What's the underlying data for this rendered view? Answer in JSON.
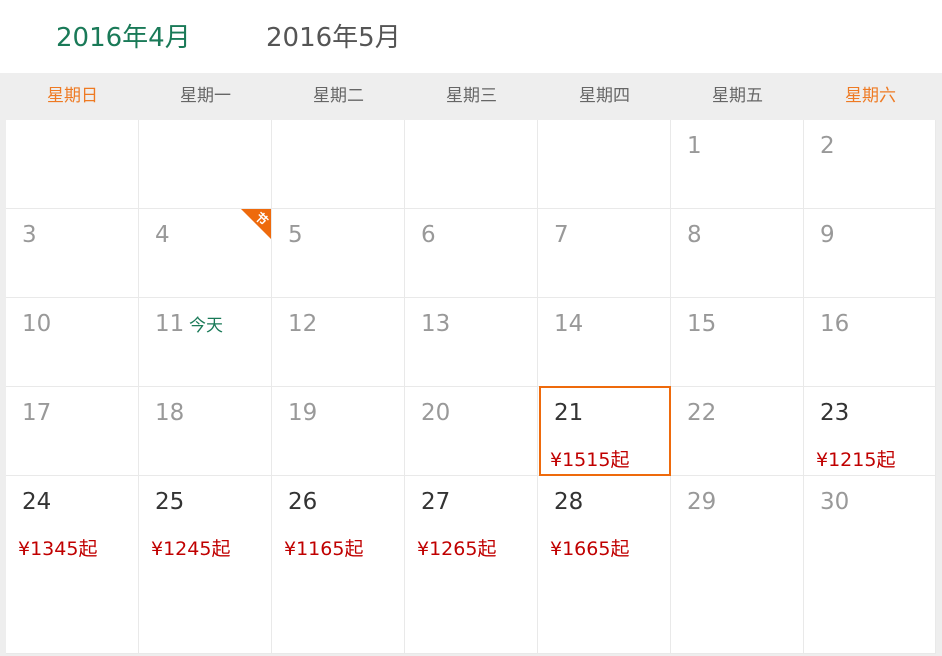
{
  "month_tabs": [
    {
      "label": "2016年4月",
      "active": true
    },
    {
      "label": "2016年5月",
      "active": false
    }
  ],
  "weekdays": [
    "星期日",
    "星期一",
    "星期二",
    "星期三",
    "星期四",
    "星期五",
    "星期六"
  ],
  "colors": {
    "active_tab": "#1a7a58",
    "weekend": "#ee7a23",
    "price": "#c00000",
    "selection": "#ee6a0c",
    "holiday_flag": "#ee6a0c"
  },
  "holiday_flag_label": "节",
  "today_label": "今天",
  "selected_day": "21",
  "weeks": [
    [
      {
        "day": ""
      },
      {
        "day": ""
      },
      {
        "day": ""
      },
      {
        "day": ""
      },
      {
        "day": ""
      },
      {
        "day": "1"
      },
      {
        "day": "2"
      }
    ],
    [
      {
        "day": "3"
      },
      {
        "day": "4",
        "holiday": true
      },
      {
        "day": "5"
      },
      {
        "day": "6"
      },
      {
        "day": "7"
      },
      {
        "day": "8"
      },
      {
        "day": "9"
      }
    ],
    [
      {
        "day": "10"
      },
      {
        "day": "11",
        "today": true
      },
      {
        "day": "12"
      },
      {
        "day": "13"
      },
      {
        "day": "14"
      },
      {
        "day": "15"
      },
      {
        "day": "16"
      }
    ],
    [
      {
        "day": "17"
      },
      {
        "day": "18"
      },
      {
        "day": "19"
      },
      {
        "day": "20"
      },
      {
        "day": "21",
        "price": "¥1515起",
        "selected": true
      },
      {
        "day": "22"
      },
      {
        "day": "23",
        "price": "¥1215起"
      }
    ],
    [
      {
        "day": "24",
        "price": "¥1345起"
      },
      {
        "day": "25",
        "price": "¥1245起"
      },
      {
        "day": "26",
        "price": "¥1165起"
      },
      {
        "day": "27",
        "price": "¥1265起"
      },
      {
        "day": "28",
        "price": "¥1665起"
      },
      {
        "day": "29"
      },
      {
        "day": "30"
      }
    ]
  ]
}
